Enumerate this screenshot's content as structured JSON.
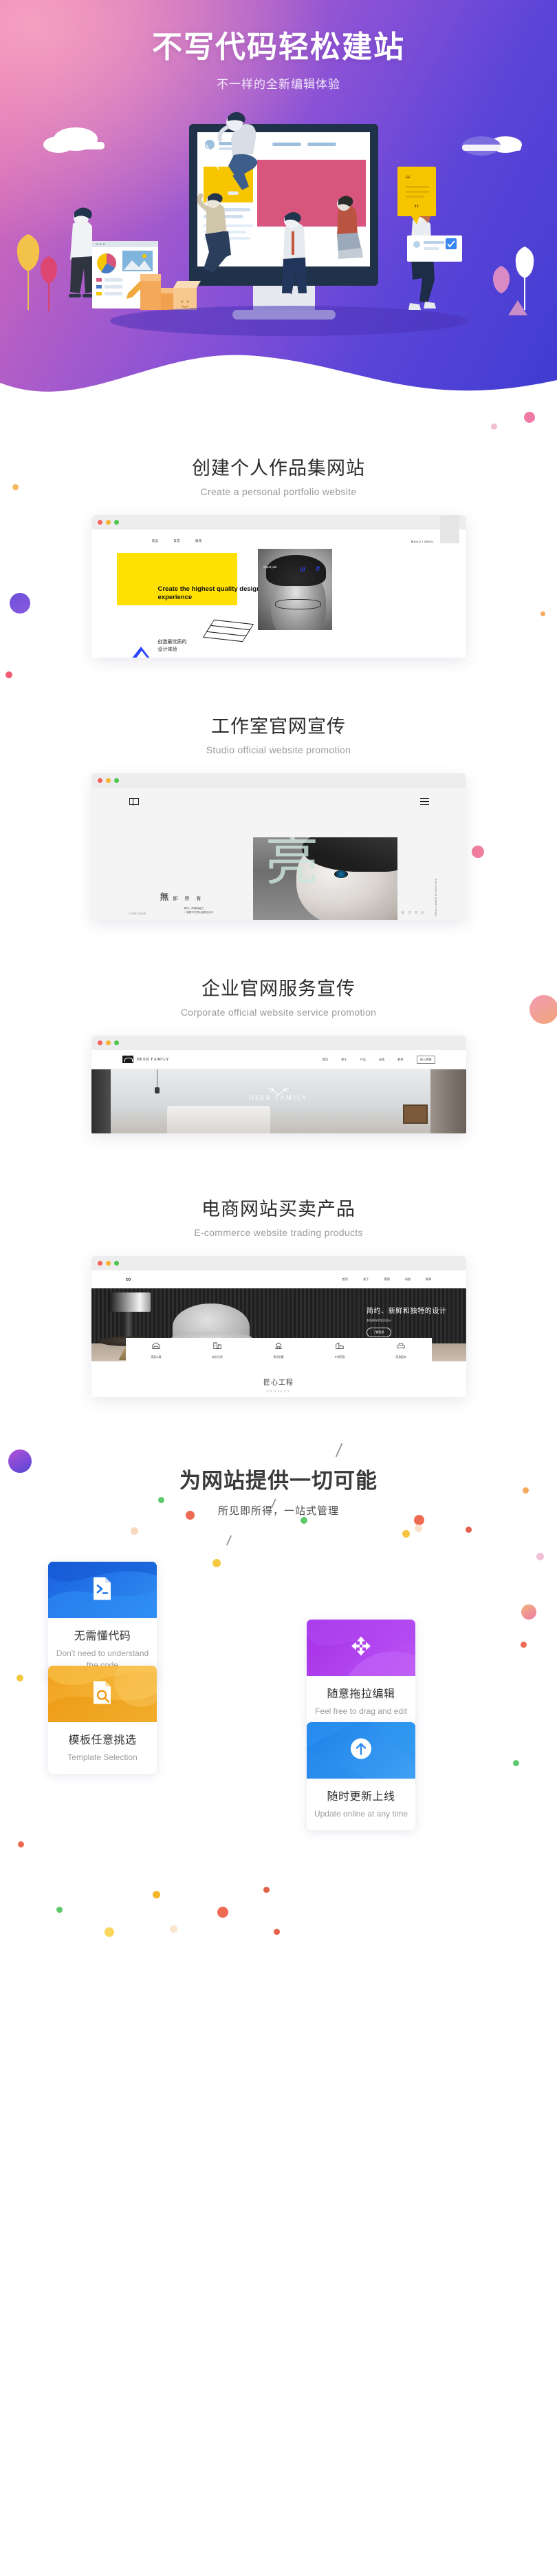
{
  "hero": {
    "title": "不写代码轻松建站",
    "subtitle": "不一样的全新编辑体验"
  },
  "sections": [
    {
      "title": "创建个人作品集网站",
      "subtitle": "Create a personal portfolio website",
      "mock": {
        "nav": [
          "作品",
          "日志",
          "联系"
        ],
        "brand": "Macro / denis.",
        "headline": "Create the highest\nquality design experience",
        "caption": "创造最优质的\n设计体验",
        "photo_note": "Good job!",
        "photo_marks": [
          "///",
          "#"
        ]
      }
    },
    {
      "title": "工作室官网宣传",
      "subtitle": "Studio official website promotion",
      "mock": {
        "word_big": "無",
        "word_rest": "即 所 有",
        "small_lines": "简约、质感和留白\n一家数字写意&品牌设计师",
        "image_char": "亮",
        "vertical_text": "NOTHING IS EVERYTHING",
        "footer_left": "© 2021 STUDIO",
        "footer_right": "MORE"
      }
    },
    {
      "title": "企业官网服务宣传",
      "subtitle": "Corporate official website service promotion",
      "mock": {
        "brand": "DEER FAMILY",
        "nav": [
          "首页",
          "关于",
          "产品",
          "动态",
          "联系"
        ],
        "cta": "进入商城",
        "hero_logo": "DEER FAMILY"
      }
    },
    {
      "title": "电商网站买卖产品",
      "subtitle": "E-commerce website trading products",
      "mock": {
        "logo": "∞",
        "nav": [
          "首页",
          "关于",
          "案例",
          "动态",
          "联系"
        ],
        "headline": "简约、新鲜和独特的设计",
        "subline": "发现更好的室内设计",
        "button": "了解更多",
        "categories": [
          {
            "icon": "🏠",
            "label": "家庭公寓"
          },
          {
            "icon": "🏢",
            "label": "商业空间"
          },
          {
            "icon": "🏛",
            "label": "豪宅别墅"
          },
          {
            "icon": "🏗",
            "label": "乡野民宿"
          },
          {
            "icon": "🛏",
            "label": "家具配饰"
          }
        ],
        "footer_cn": "匠心工程",
        "footer_en": "PROJECT"
      }
    }
  ],
  "claim": {
    "title": "为网站提供一切可能",
    "subtitle": "所见即所得，一站式管理"
  },
  "features": [
    {
      "cn": "无需懂代码",
      "en": "Don't need to understand the code",
      "icon": "code-file-icon",
      "color_from": "#1f6fe8",
      "color_to": "#2b86f0"
    },
    {
      "cn": "随意拖拉编辑",
      "en": "Feel free to drag and edit",
      "icon": "move-arrows-icon",
      "color_from": "#a236e8",
      "color_to": "#b94ff2"
    },
    {
      "cn": "模板任意挑选",
      "en": "Template Selection",
      "icon": "template-search-icon",
      "color_from": "#ef9a17",
      "color_to": "#f7b93c"
    },
    {
      "cn": "随时更新上线",
      "en": "Update online at any time",
      "icon": "upload-arrow-icon",
      "color_from": "#1e86e8",
      "color_to": "#3f9df3"
    }
  ],
  "colors": {
    "hero_pink": "#e86fae",
    "hero_purple": "#8a52d6",
    "hero_blue": "#3f3bd1",
    "accent_yellow": "#ffe000",
    "text_dark": "#2b2b2b",
    "text_muted": "#9a9a9a"
  }
}
